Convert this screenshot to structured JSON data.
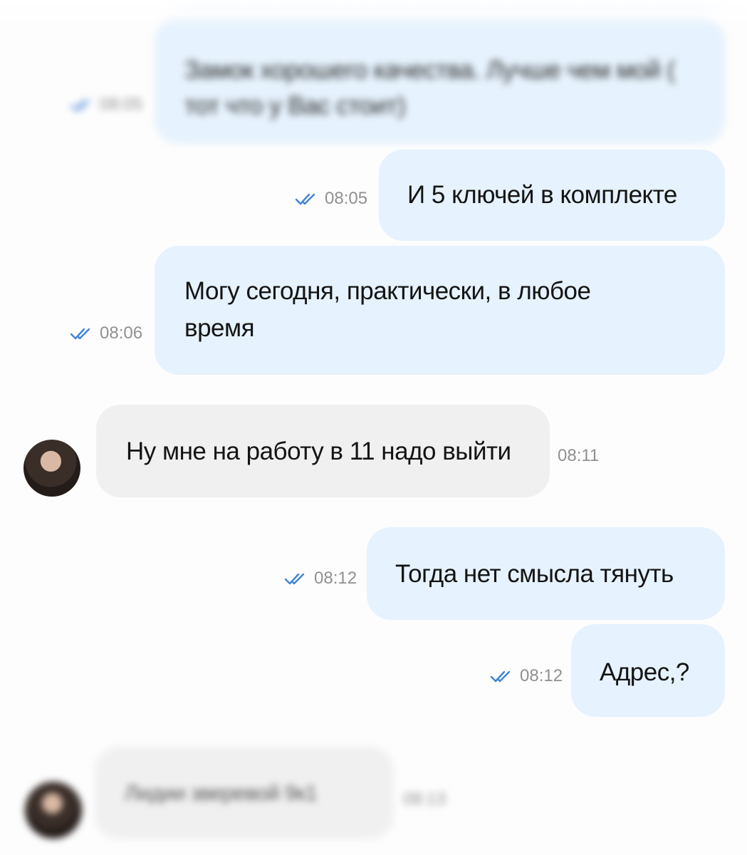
{
  "colors": {
    "outgoing_bubble": "#e6f2fd",
    "incoming_bubble": "#f0f0f0",
    "read_check": "#3f84d8",
    "timestamp": "#909090"
  },
  "messages": [
    {
      "direction": "out",
      "text": "Замок хорошего качества. Лучше чем мой ( тот что у Вас стоит)",
      "time": "08:05",
      "status_icon": "double-check-icon",
      "blurred": true
    },
    {
      "direction": "out",
      "text": "И 5 ключей в комплекте",
      "time": "08:05",
      "status_icon": "double-check-icon",
      "blurred": false
    },
    {
      "direction": "out",
      "text": "Могу сегодня, практически, в любое время",
      "time": "08:06",
      "status_icon": "double-check-icon",
      "blurred": false
    },
    {
      "direction": "in",
      "text": "Ну мне на работу в 11 надо выйти",
      "time": "08:11",
      "avatar": "contact-avatar",
      "blurred": false
    },
    {
      "direction": "out",
      "text": "Тогда нет смысла тянуть",
      "time": "08:12",
      "status_icon": "double-check-icon",
      "blurred": false
    },
    {
      "direction": "out",
      "text": "Адрес,?",
      "time": "08:12",
      "status_icon": "double-check-icon",
      "blurred": false
    },
    {
      "direction": "in",
      "text": "Лидии зверевой 9к1",
      "time": "08:13",
      "avatar": "contact-avatar",
      "blurred": true
    }
  ]
}
